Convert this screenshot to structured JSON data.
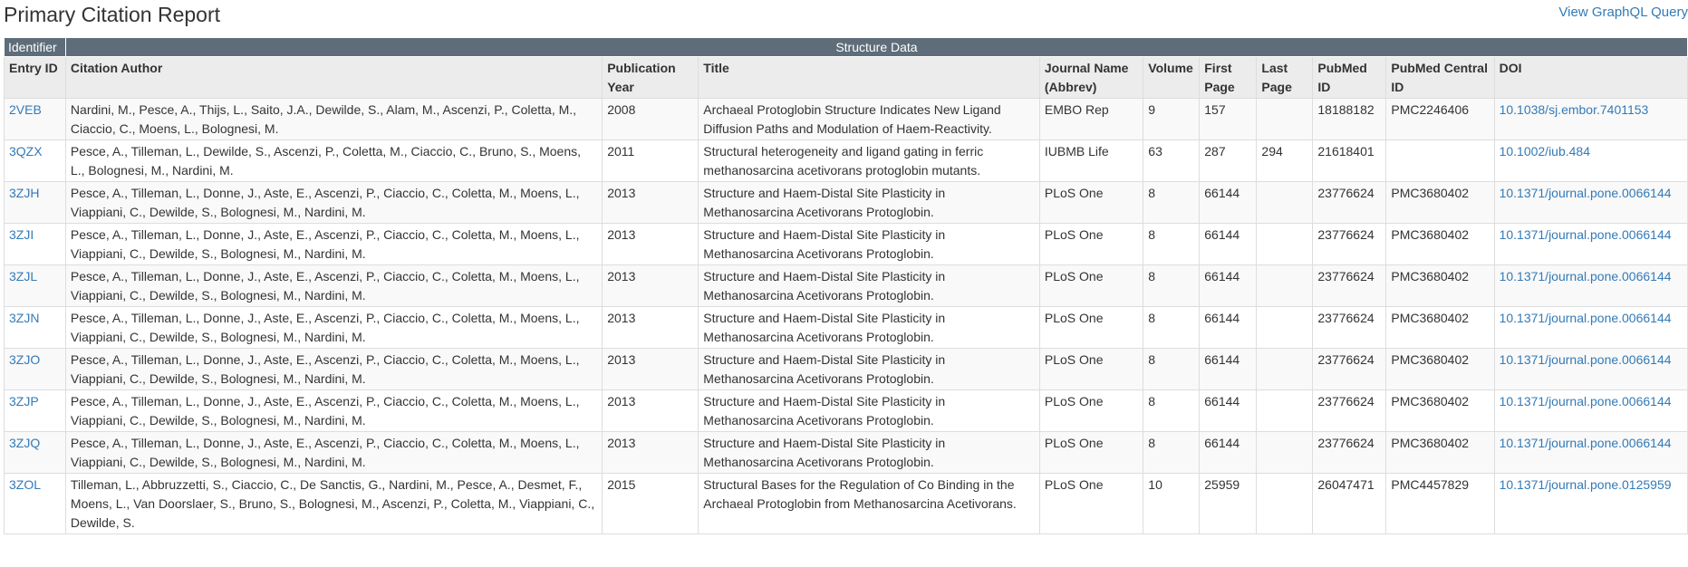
{
  "page": {
    "title": "Primary Citation Report",
    "graphql_link": "View GraphQL Query"
  },
  "table": {
    "groups": {
      "identifier": "Identifier",
      "structure_data": "Structure Data"
    },
    "columns": [
      "Entry ID",
      "Citation Author",
      "Publication Year",
      "Title",
      "Journal Name (Abbrev)",
      "Volume",
      "First Page",
      "Last Page",
      "PubMed ID",
      "PubMed Central ID",
      "DOI"
    ],
    "rows": [
      {
        "entry_id": "2VEB",
        "author": "Nardini, M., Pesce, A., Thijs, L., Saito, J.A., Dewilde, S., Alam, M., Ascenzi, P., Coletta, M., Ciaccio, C., Moens, L., Bolognesi, M.",
        "year": "2008",
        "title": "Archaeal Protoglobin Structure Indicates New Ligand Diffusion Paths and Modulation of Haem-Reactivity.",
        "journal": "EMBO Rep",
        "volume": "9",
        "first_page": "157",
        "last_page": "",
        "pubmed_id": "18188182",
        "pmc_id": "PMC2246406",
        "doi": "10.1038/sj.embor.7401153"
      },
      {
        "entry_id": "3QZX",
        "author": "Pesce, A., Tilleman, L., Dewilde, S., Ascenzi, P., Coletta, M., Ciaccio, C., Bruno, S., Moens, L., Bolognesi, M., Nardini, M.",
        "year": "2011",
        "title": "Structural heterogeneity and ligand gating in ferric methanosarcina acetivorans protoglobin mutants.",
        "journal": "IUBMB Life",
        "volume": "63",
        "first_page": "287",
        "last_page": "294",
        "pubmed_id": "21618401",
        "pmc_id": "",
        "doi": "10.1002/iub.484"
      },
      {
        "entry_id": "3ZJH",
        "author": "Pesce, A., Tilleman, L., Donne, J., Aste, E., Ascenzi, P., Ciaccio, C., Coletta, M., Moens, L., Viappiani, C., Dewilde, S., Bolognesi, M., Nardini, M.",
        "year": "2013",
        "title": "Structure and Haem-Distal Site Plasticity in Methanosarcina Acetivorans Protoglobin.",
        "journal": "PLoS One",
        "volume": "8",
        "first_page": "66144",
        "last_page": "",
        "pubmed_id": "23776624",
        "pmc_id": "PMC3680402",
        "doi": "10.1371/journal.pone.0066144"
      },
      {
        "entry_id": "3ZJI",
        "author": "Pesce, A., Tilleman, L., Donne, J., Aste, E., Ascenzi, P., Ciaccio, C., Coletta, M., Moens, L., Viappiani, C., Dewilde, S., Bolognesi, M., Nardini, M.",
        "year": "2013",
        "title": "Structure and Haem-Distal Site Plasticity in Methanosarcina Acetivorans Protoglobin.",
        "journal": "PLoS One",
        "volume": "8",
        "first_page": "66144",
        "last_page": "",
        "pubmed_id": "23776624",
        "pmc_id": "PMC3680402",
        "doi": "10.1371/journal.pone.0066144"
      },
      {
        "entry_id": "3ZJL",
        "author": "Pesce, A., Tilleman, L., Donne, J., Aste, E., Ascenzi, P., Ciaccio, C., Coletta, M., Moens, L., Viappiani, C., Dewilde, S., Bolognesi, M., Nardini, M.",
        "year": "2013",
        "title": "Structure and Haem-Distal Site Plasticity in Methanosarcina Acetivorans Protoglobin.",
        "journal": "PLoS One",
        "volume": "8",
        "first_page": "66144",
        "last_page": "",
        "pubmed_id": "23776624",
        "pmc_id": "PMC3680402",
        "doi": "10.1371/journal.pone.0066144"
      },
      {
        "entry_id": "3ZJN",
        "author": "Pesce, A., Tilleman, L., Donne, J., Aste, E., Ascenzi, P., Ciaccio, C., Coletta, M., Moens, L., Viappiani, C., Dewilde, S., Bolognesi, M., Nardini, M.",
        "year": "2013",
        "title": "Structure and Haem-Distal Site Plasticity in Methanosarcina Acetivorans Protoglobin.",
        "journal": "PLoS One",
        "volume": "8",
        "first_page": "66144",
        "last_page": "",
        "pubmed_id": "23776624",
        "pmc_id": "PMC3680402",
        "doi": "10.1371/journal.pone.0066144"
      },
      {
        "entry_id": "3ZJO",
        "author": "Pesce, A., Tilleman, L., Donne, J., Aste, E., Ascenzi, P., Ciaccio, C., Coletta, M., Moens, L., Viappiani, C., Dewilde, S., Bolognesi, M., Nardini, M.",
        "year": "2013",
        "title": "Structure and Haem-Distal Site Plasticity in Methanosarcina Acetivorans Protoglobin.",
        "journal": "PLoS One",
        "volume": "8",
        "first_page": "66144",
        "last_page": "",
        "pubmed_id": "23776624",
        "pmc_id": "PMC3680402",
        "doi": "10.1371/journal.pone.0066144"
      },
      {
        "entry_id": "3ZJP",
        "author": "Pesce, A., Tilleman, L., Donne, J., Aste, E., Ascenzi, P., Ciaccio, C., Coletta, M., Moens, L., Viappiani, C., Dewilde, S., Bolognesi, M., Nardini, M.",
        "year": "2013",
        "title": "Structure and Haem-Distal Site Plasticity in Methanosarcina Acetivorans Protoglobin.",
        "journal": "PLoS One",
        "volume": "8",
        "first_page": "66144",
        "last_page": "",
        "pubmed_id": "23776624",
        "pmc_id": "PMC3680402",
        "doi": "10.1371/journal.pone.0066144"
      },
      {
        "entry_id": "3ZJQ",
        "author": "Pesce, A., Tilleman, L., Donne, J., Aste, E., Ascenzi, P., Ciaccio, C., Coletta, M., Moens, L., Viappiani, C., Dewilde, S., Bolognesi, M., Nardini, M.",
        "year": "2013",
        "title": "Structure and Haem-Distal Site Plasticity in Methanosarcina Acetivorans Protoglobin.",
        "journal": "PLoS One",
        "volume": "8",
        "first_page": "66144",
        "last_page": "",
        "pubmed_id": "23776624",
        "pmc_id": "PMC3680402",
        "doi": "10.1371/journal.pone.0066144"
      },
      {
        "entry_id": "3ZOL",
        "author": "Tilleman, L., Abbruzzetti, S., Ciaccio, C., De Sanctis, G., Nardini, M., Pesce, A., Desmet, F., Moens, L., Van Doorslaer, S., Bruno, S., Bolognesi, M., Ascenzi, P., Coletta, M., Viappiani, C., Dewilde, S.",
        "year": "2015",
        "title": "Structural Bases for the Regulation of Co Binding in the Archaeal Protoglobin from Methanosarcina Acetivorans.",
        "journal": "PLoS One",
        "volume": "10",
        "first_page": "25959",
        "last_page": "",
        "pubmed_id": "26047471",
        "pmc_id": "PMC4457829",
        "doi": "10.1371/journal.pone.0125959"
      }
    ]
  },
  "colors": {
    "group_header_bg": "#5e6d79",
    "column_header_bg": "#ececec",
    "link": "#337ab7",
    "text": "#333333"
  }
}
